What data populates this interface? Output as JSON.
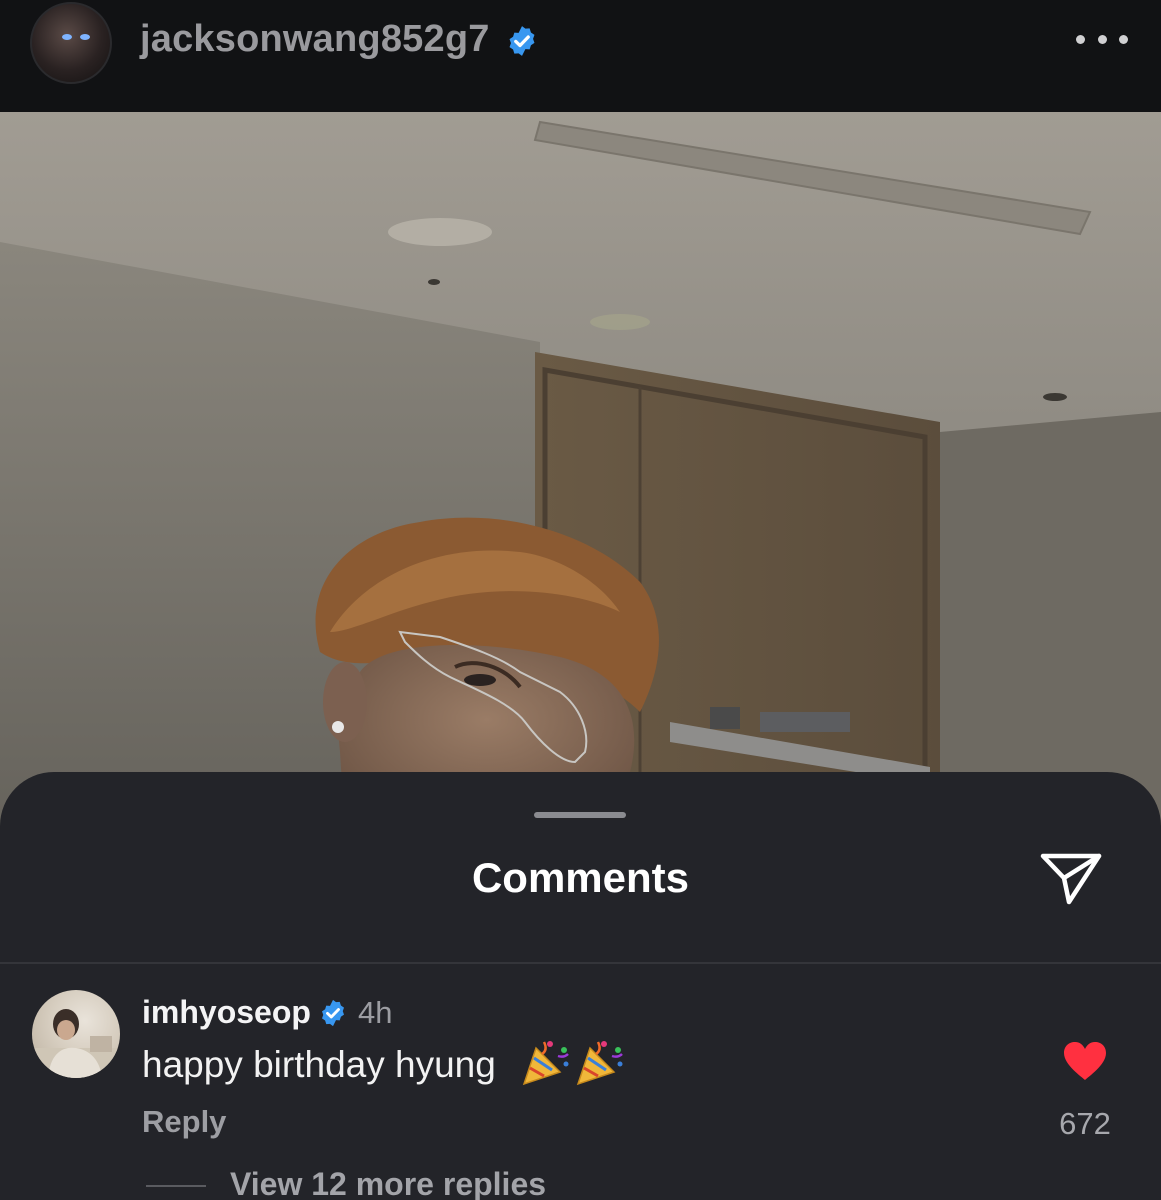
{
  "header": {
    "username": "jacksonwang852g7",
    "verified": true
  },
  "photo": {
    "alt": "selfie photo"
  },
  "comments_sheet": {
    "title": "Comments"
  },
  "comments": [
    {
      "username": "imhyoseop",
      "verified": true,
      "time": "4h",
      "text": "happy birthday hyung",
      "emoji": "party-popper-icon x2",
      "reply_label": "Reply",
      "likes": "672",
      "liked": true,
      "view_replies_label": "View 12 more replies"
    }
  ],
  "colors": {
    "verified_blue": "#3897f0",
    "like_red": "#ff3040",
    "sheet_bg": "#232429",
    "header_bg": "#111214"
  }
}
